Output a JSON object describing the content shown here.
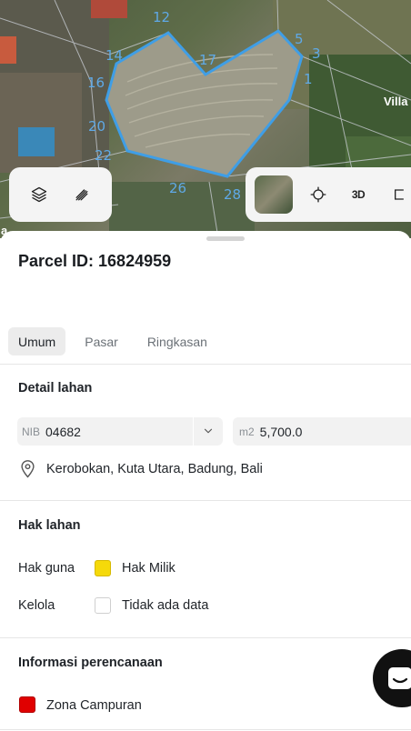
{
  "map": {
    "plot_labels": [
      "12",
      "14",
      "16",
      "17",
      "5",
      "3",
      "1",
      "20",
      "22",
      "26",
      "28"
    ],
    "place_label": "Villa",
    "edge_label": "a",
    "three_d_label": "3D"
  },
  "parcel": {
    "title": "Parcel ID: 16824959"
  },
  "tabs": [
    {
      "label": "Umum",
      "active": true
    },
    {
      "label": "Pasar",
      "active": false
    },
    {
      "label": "Ringkasan",
      "active": false
    }
  ],
  "detail": {
    "section_title": "Detail lahan",
    "nib_prefix": "NIB",
    "nib_value": "04682",
    "area_prefix": "m2",
    "area_value": "5,700.0",
    "location": "Kerobokan, Kuta Utara, Badung, Bali"
  },
  "rights": {
    "section_title": "Hak lahan",
    "rows": [
      {
        "label": "Hak guna",
        "value": "Hak Milik",
        "color": "#f5d90a"
      },
      {
        "label": "Kelola",
        "value": "Tidak ada data",
        "color": "#ffffff"
      }
    ]
  },
  "planning": {
    "section_title": "Informasi perencanaan",
    "zone_label": "Zona Campuran",
    "zone_color": "#e00000"
  }
}
